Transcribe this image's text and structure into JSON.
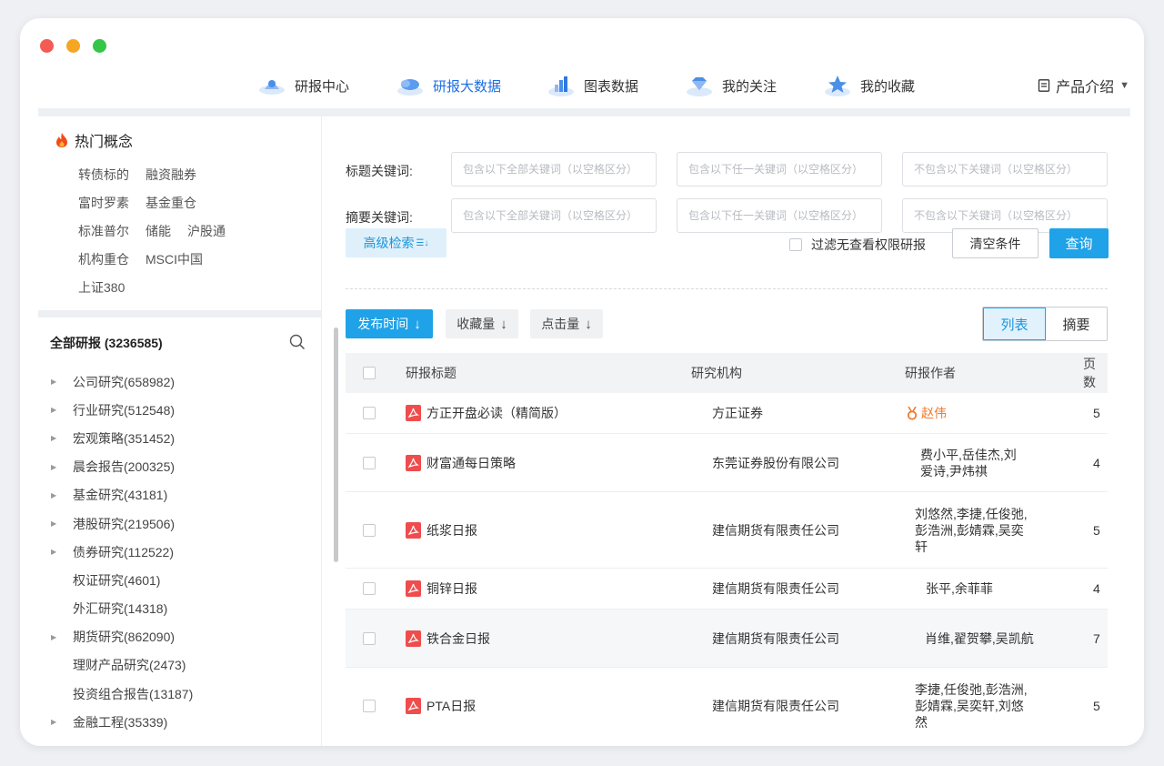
{
  "nav": {
    "items": [
      {
        "label": "研报中心",
        "icon": "research-center-icon",
        "active": false
      },
      {
        "label": "研报大数据",
        "icon": "big-data-cloud-icon",
        "active": true
      },
      {
        "label": "图表数据",
        "icon": "bar-chart-icon",
        "active": false
      },
      {
        "label": "我的关注",
        "icon": "diamond-icon",
        "active": false
      },
      {
        "label": "我的收藏",
        "icon": "star-icon",
        "active": false
      }
    ],
    "product_label": "产品介绍"
  },
  "sidebar": {
    "hot_title": "热门概念",
    "hot_tags": [
      [
        "转债标的",
        "融资融券"
      ],
      [
        "富时罗素",
        "基金重仓"
      ],
      [
        "标准普尔",
        "储能",
        "沪股通"
      ],
      [
        "机构重仓",
        "MSCI中国"
      ],
      [
        "上证380"
      ]
    ],
    "all_reports_label": "全部研报 (3236585)",
    "tree": [
      {
        "label": "公司研究(658982)",
        "expandable": true
      },
      {
        "label": "行业研究(512548)",
        "expandable": true
      },
      {
        "label": "宏观策略(351452)",
        "expandable": true
      },
      {
        "label": "晨会报告(200325)",
        "expandable": true
      },
      {
        "label": "基金研究(43181)",
        "expandable": true
      },
      {
        "label": "港股研究(219506)",
        "expandable": true
      },
      {
        "label": "债券研究(112522)",
        "expandable": true
      },
      {
        "label": "权证研究(4601)",
        "expandable": false
      },
      {
        "label": "外汇研究(14318)",
        "expandable": false
      },
      {
        "label": "期货研究(862090)",
        "expandable": true
      },
      {
        "label": "理财产品研究(2473)",
        "expandable": false
      },
      {
        "label": "投资组合报告(13187)",
        "expandable": false
      },
      {
        "label": "金融工程(35339)",
        "expandable": true
      }
    ]
  },
  "form": {
    "title_label": "标题关键词:",
    "abstract_label": "摘要关键词:",
    "placeholder_all": "包含以下全部关键词（以空格区分）",
    "placeholder_any": "包含以下任一关键词（以空格区分）",
    "placeholder_none": "不包含以下关键词（以空格区分）",
    "advanced_label": "高级检索",
    "filter_label": "过滤无查看权限研报",
    "clear_label": "清空条件",
    "query_label": "查询"
  },
  "sort": {
    "publish_time": "发布时间",
    "favorites": "收藏量",
    "clicks": "点击量"
  },
  "view": {
    "list": "列表",
    "abstract": "摘要"
  },
  "table": {
    "headers": [
      "研报标题",
      "研究机构",
      "研报作者",
      "页数"
    ],
    "rows": [
      {
        "title": "方正开盘必读（精简版）",
        "org": "方正证券",
        "author": "赵伟",
        "pages": "5"
      },
      {
        "title": "财富通每日策略",
        "org": "东莞证券股份有限公司",
        "author": "费小平,岳佳杰,刘爱诗,尹炜祺",
        "pages": "4"
      },
      {
        "title": "纸浆日报",
        "org": "建信期货有限责任公司",
        "author": "刘悠然,李捷,任俊弛,彭浩洲,彭婧霖,吴奕轩",
        "pages": "5"
      },
      {
        "title": "铜锌日报",
        "org": "建信期货有限责任公司",
        "author": "张平,余菲菲",
        "pages": "4"
      },
      {
        "title": "铁合金日报",
        "org": "建信期货有限责任公司",
        "author": "肖维,翟贺攀,吴凯航",
        "pages": "7"
      },
      {
        "title": "PTA日报",
        "org": "建信期货有限责任公司",
        "author": "李捷,任俊弛,彭浩洲,彭婧霖,吴奕轩,刘悠然",
        "pages": "5"
      }
    ]
  },
  "colors": {
    "accent": "#1fa2e8",
    "active_nav": "#1d6ee6",
    "pdf_red": "#ef4d4d",
    "author_highlight": "#f07a2c"
  }
}
